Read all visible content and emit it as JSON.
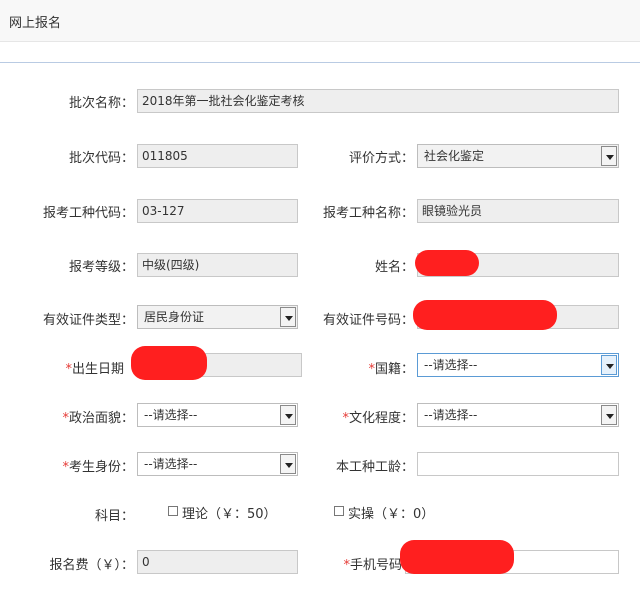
{
  "header": {
    "title": "网上报名"
  },
  "form": {
    "batch_name": {
      "label": "批次名称：",
      "value": "2018年第一批社会化鉴定考核"
    },
    "batch_code": {
      "label": "批次代码：",
      "value": "011805"
    },
    "eval_method": {
      "label": "评价方式：",
      "value": "社会化鉴定"
    },
    "job_code": {
      "label": "报考工种代码：",
      "value": "03-127"
    },
    "job_name": {
      "label": "报考工种名称：",
      "value": "眼镜验光员"
    },
    "level": {
      "label": "报考等级：",
      "value": "中级(四级)"
    },
    "name": {
      "label": "姓名：",
      "value": ""
    },
    "id_type": {
      "label": "有效证件类型：",
      "value": "居民身份证"
    },
    "id_number": {
      "label": "有效证件号码：",
      "value": ""
    },
    "birth_date": {
      "required": "*",
      "label": "出生日期",
      "value": ""
    },
    "nationality": {
      "required": "*",
      "label": "国籍：",
      "value": "--请选择--"
    },
    "political": {
      "required": "*",
      "label": "政治面貌：",
      "value": "--请选择--"
    },
    "education": {
      "required": "*",
      "label": "文化程度：",
      "value": "--请选择--"
    },
    "identity": {
      "required": "*",
      "label": "考生身份：",
      "value": "--请选择--"
    },
    "work_years": {
      "label": "本工种工龄：",
      "value": ""
    },
    "subjects": {
      "label": "科目：",
      "theory": "理论（￥：50）",
      "practice": "实操（￥：0）"
    },
    "fee": {
      "label": "报名费（￥）：",
      "value": "0"
    },
    "phone": {
      "required": "*",
      "label": "手机号码",
      "value": ""
    }
  },
  "colors": {
    "required": "#e53935",
    "redaction": "#ff1f1f",
    "accent": "#5b9bd5"
  }
}
